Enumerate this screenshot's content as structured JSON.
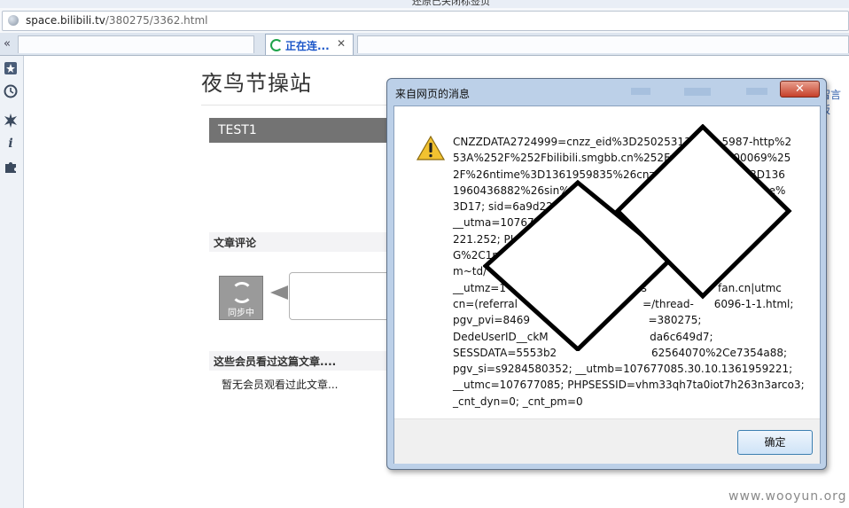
{
  "window": {
    "top_strip_text": "还原已关闭标签页"
  },
  "address_bar": {
    "url_domain": "space.bilibili.tv",
    "url_path": "/380275/3362.html"
  },
  "tabs": {
    "active_tab_label": "正在连...",
    "close_glyph": "✕",
    "back_glyph": "«"
  },
  "sidebar": {
    "icons": [
      "bookmark-icon",
      "history-icon",
      "gear-burst-icon",
      "info-icon",
      "puzzle-icon"
    ]
  },
  "page": {
    "site_title": "夜鸟节操站",
    "article_title": "TEST1",
    "comments_section": "文章评论",
    "sync_label": "同步中",
    "viewers_section": "这些会员看过这篇文章....",
    "no_viewers_text": "暂无会员观看过此文章...",
    "right_fragment": "留言板"
  },
  "dialog": {
    "title": "来自网页的消息",
    "close_glyph": "✕",
    "message_lines": [
      "CNZZDATA2724999=cnzz_eid%3D25025313-1      5987-http%2",
      "53A%252F%252Fbilibili.smgbb.cn%252Fvid              00069%25",
      "2F%26ntime%3D1361959835%26cnzz_a                    %3D136",
      "1960436882%26sin%3                     6ltime%3                     e%",
      "3D17; sid=6a9d228",
      "__utma=107677",
      "221.252; PLHi",
      "G%2C1pM                                                           WCg|",
      "m~td/",
      "__utmz=1                                  tmcs                     fan.cn|utmc",
      "cn=(referral                                     =/thread-      6096-1-1.html;",
      "pgv_pvi=8469                                   =380275;",
      "DedeUserID__ckM                              da6c649d7;",
      "SESSDATA=5553b2                            62564070%2Ce7354a88;",
      "pgv_si=s9284580352; __utmb=107677085.30.10.1361959221;",
      "__utmc=107677085; PHPSESSID=vhm33qh7ta0iot7h263n3arco3;",
      "_cnt_dyn=0; _cnt_pm=0"
    ],
    "ok_label": "确定"
  },
  "footer": {
    "watermark": "www.wooyun.org"
  },
  "colors": {
    "article_bar": "#737373",
    "dialog_frame": "#bcd0e8",
    "link_blue": "#2a5aa8"
  }
}
